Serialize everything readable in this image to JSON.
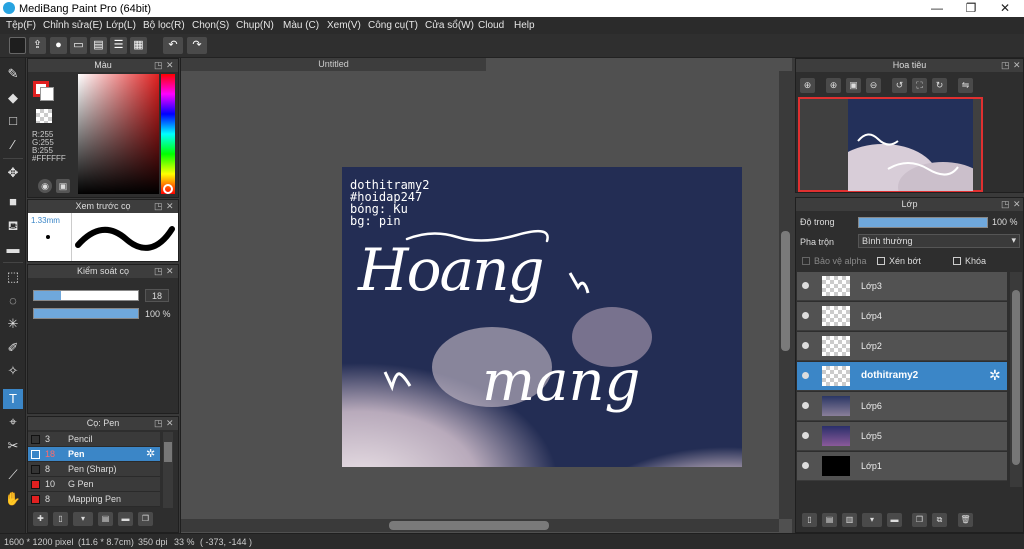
{
  "window": {
    "title": "MediBang Paint Pro (64bit)",
    "minimize": "—",
    "restore": "❐",
    "close": "✕"
  },
  "menu": [
    "Tệp(F)",
    "Chỉnh sửa(E)",
    "Lớp(L)",
    "Bộ lọc(R)",
    "Chọn(S)",
    "Chụp(N)",
    "Màu (C)",
    "Xem(V)",
    "Công cụ(T)",
    "Cửa sổ(W)",
    "Cloud",
    "Help"
  ],
  "color_panel": {
    "title": "Màu",
    "r": "R:255",
    "g": "G:255",
    "b": "B:255",
    "hex": "#FFFFFF",
    "primary_color": "#e02020",
    "hue_marker": "hue-ring-icon"
  },
  "preview_panel": {
    "title": "Xem trước cọ",
    "size": "1.33mm"
  },
  "brush_control": {
    "title": "Kiểm soát cọ",
    "size_value": "18",
    "size_fill": 0.26,
    "opacity_value": "100 %",
    "opacity_fill": 1.0
  },
  "brush_panel": {
    "title": "Cọ: Pen",
    "brushes": [
      {
        "size": "3",
        "name": "Pencil",
        "color": "#333333"
      },
      {
        "size": "18",
        "name": "Pen",
        "color": "#3b86c7"
      },
      {
        "size": "8",
        "name": "Pen (Sharp)",
        "color": "#333333"
      },
      {
        "size": "10",
        "name": "G Pen",
        "color": "#e02020"
      },
      {
        "size": "8",
        "name": "Mapping Pen",
        "color": "#e02020"
      }
    ]
  },
  "canvas": {
    "tab": "Untitled",
    "credit_lines": [
      "dothitramy2",
      "#hoidap247",
      "bóng: Ku",
      "bg: pin"
    ],
    "lettering": [
      "Hoang",
      "mang"
    ]
  },
  "navigator": {
    "title": "Hoa tiêu"
  },
  "layer_panel": {
    "title": "Lớp",
    "opacity_label": "Độ trong",
    "opacity_value": "100 %",
    "opacity_fill": 1.0,
    "blend_label": "Pha trộn",
    "blend_value": "Bình thường",
    "protect_alpha": "Bảo vệ alpha",
    "clipping": "Xén bớt",
    "lock": "Khóa",
    "layers": [
      {
        "name": "Lớp3",
        "thumb": "transparent"
      },
      {
        "name": "Lớp4",
        "thumb": "transparent"
      },
      {
        "name": "Lớp2",
        "thumb": "transparent"
      },
      {
        "name": "dothitramy2",
        "thumb": "transparent",
        "selected": true
      },
      {
        "name": "Lớp6",
        "thumb": "sky"
      },
      {
        "name": "Lớp5",
        "thumb": "sky-purple"
      },
      {
        "name": "Lớp1",
        "thumb": "black"
      }
    ]
  },
  "status": {
    "size": "1600 * 1200 pixel",
    "cm": "(11.6 * 8.7cm)",
    "dpi": "350 dpi",
    "zoom": "33 %",
    "coords": "( -373, -144 )"
  }
}
